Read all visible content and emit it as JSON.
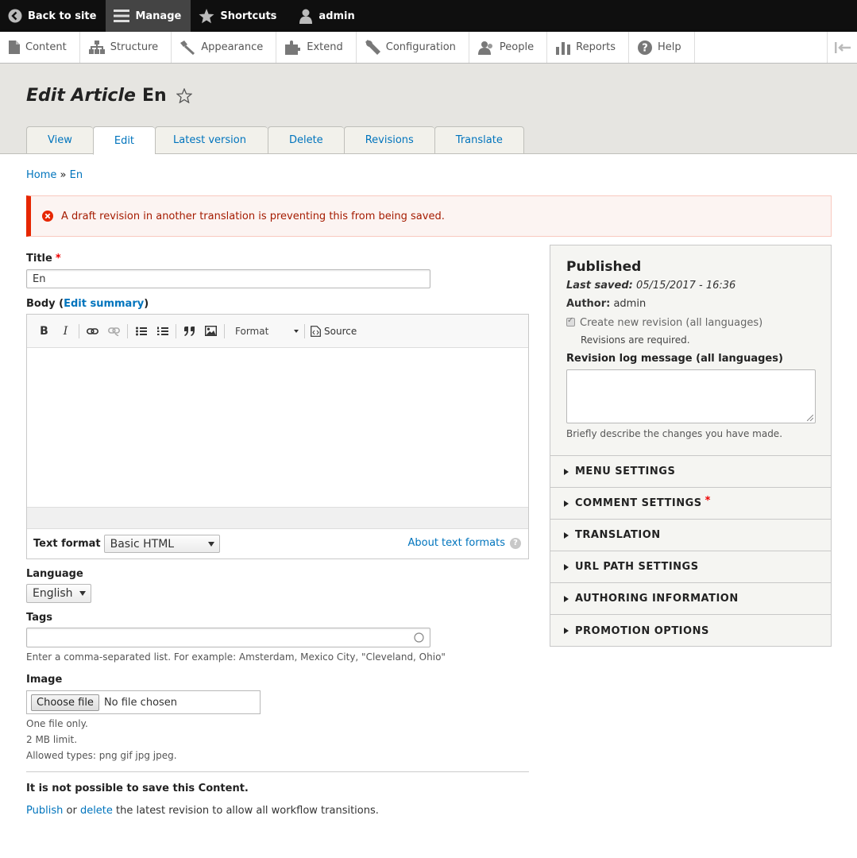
{
  "toolbar": {
    "back": "Back to site",
    "manage": "Manage",
    "shortcuts": "Shortcuts",
    "user": "admin"
  },
  "tray": {
    "items": [
      "Content",
      "Structure",
      "Appearance",
      "Extend",
      "Configuration",
      "People",
      "Reports",
      "Help"
    ]
  },
  "page": {
    "title_prefix": "Edit Article",
    "title_name": "En",
    "tabs": [
      "View",
      "Edit",
      "Latest version",
      "Delete",
      "Revisions",
      "Translate"
    ],
    "active_tab": "Edit"
  },
  "breadcrumb": {
    "home": "Home",
    "sep": "»",
    "current": "En"
  },
  "error": "A draft revision in another translation is preventing this from being saved.",
  "form": {
    "title_label": "Title",
    "title_value": "En",
    "body_label": "Body (",
    "edit_summary": "Edit summary",
    "body_label_end": ")",
    "editor": {
      "bold": "B",
      "italic": "I",
      "format": "Format",
      "source": "Source"
    },
    "text_format_label": "Text format",
    "text_format_value": "Basic HTML",
    "about_formats": "About text formats",
    "language_label": "Language",
    "language_value": "English",
    "tags_label": "Tags",
    "tags_value": "",
    "tags_desc": "Enter a comma-separated list. For example: Amsterdam, Mexico City, \"Cleveland, Ohio\"",
    "image_label": "Image",
    "choose_file": "Choose file",
    "no_file": "No file chosen",
    "image_desc": [
      "One file only.",
      "2 MB limit.",
      "Allowed types: png gif jpg jpeg."
    ],
    "cannot_save": "It is not possible to save this Content.",
    "publish": "Publish",
    "or": "or",
    "delete": "delete",
    "tail": "the latest revision to allow all workflow transitions."
  },
  "sidebar": {
    "status": "Published",
    "last_saved_label": "Last saved:",
    "last_saved_value": "05/15/2017 - 16:36",
    "author_label": "Author:",
    "author_value": "admin",
    "new_revision": "Create new revision (all languages)",
    "revisions_required": "Revisions are required.",
    "log_label": "Revision log message (all languages)",
    "log_value": "",
    "log_desc": "Briefly describe the changes you have made.",
    "sections": [
      "MENU SETTINGS",
      "COMMENT SETTINGS",
      "TRANSLATION",
      "URL PATH SETTINGS",
      "AUTHORING INFORMATION",
      "PROMOTION OPTIONS"
    ]
  }
}
